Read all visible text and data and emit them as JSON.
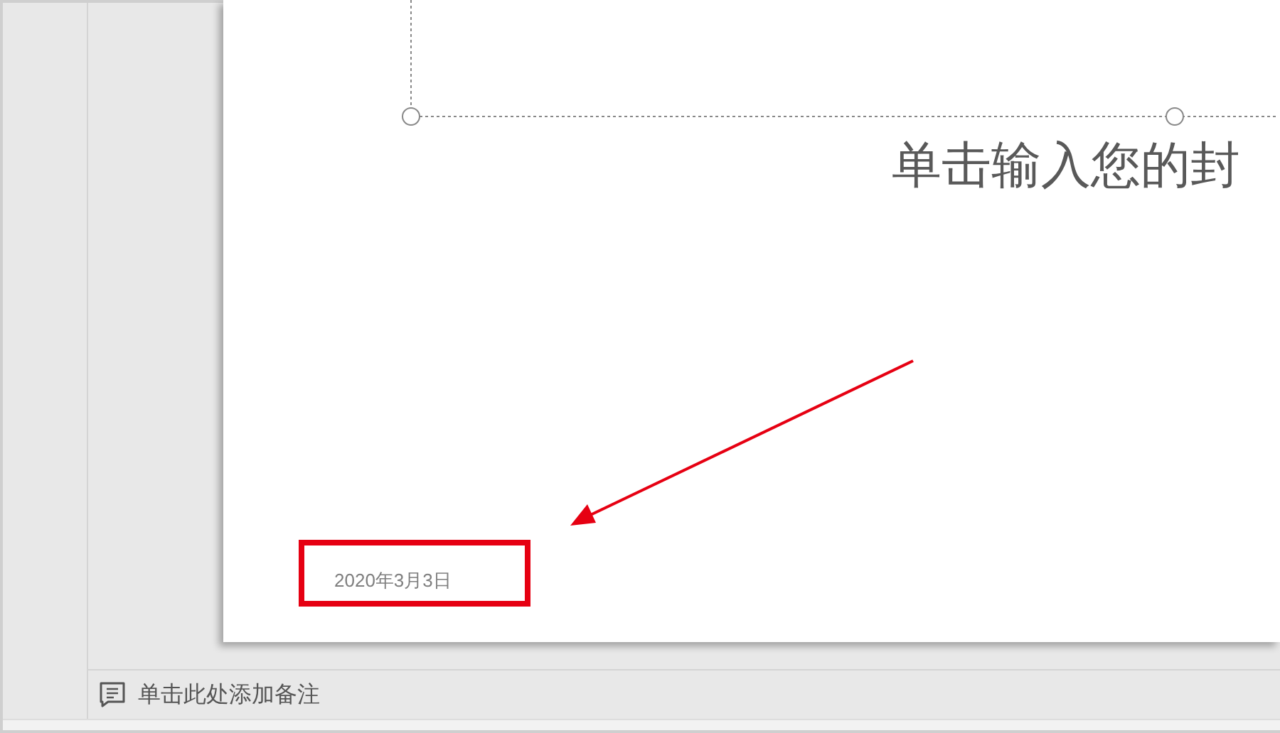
{
  "slide": {
    "title": "单击输入您的封",
    "date": "2020年3月3日"
  },
  "annotation": {
    "color": "#e60012"
  },
  "notes": {
    "placeholder": "单击此处添加备注"
  }
}
